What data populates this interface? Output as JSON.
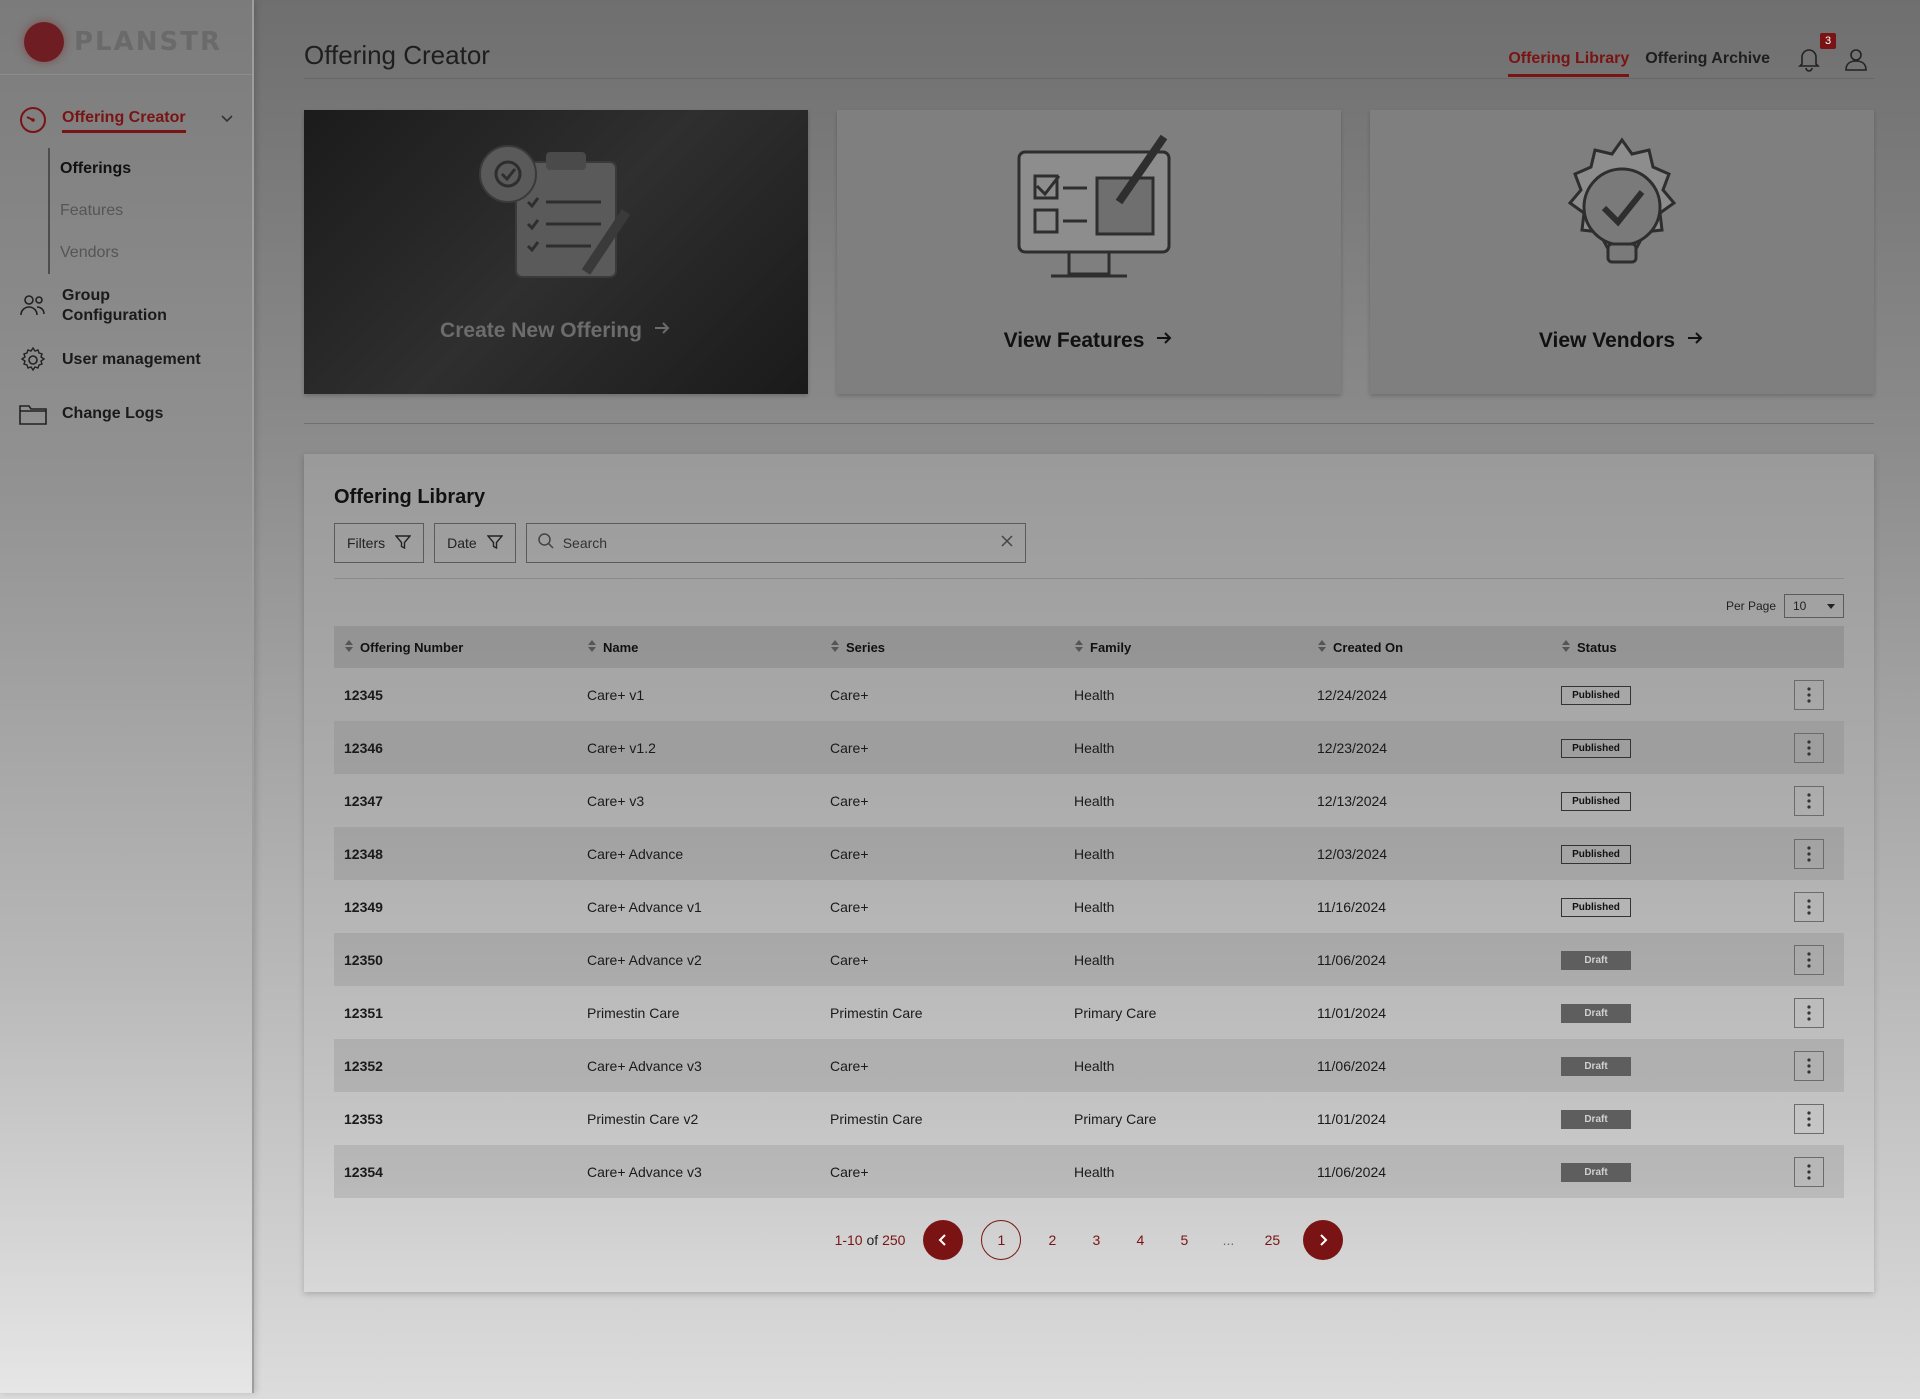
{
  "brand": {
    "logo_text": "PLANSTR"
  },
  "header": {
    "title": "Offering Creator",
    "tabs": [
      {
        "label": "Offering Library"
      },
      {
        "label": "Offering Archive"
      }
    ],
    "notification_count": "3"
  },
  "sidebar": {
    "group": {
      "label": "Offering Creator"
    },
    "sub_items": [
      {
        "label": "Offerings"
      },
      {
        "label": "Features"
      },
      {
        "label": "Vendors"
      }
    ],
    "items": [
      {
        "label": "Group Configuration"
      },
      {
        "label": "User management"
      },
      {
        "label": "Change Logs"
      }
    ]
  },
  "cards": [
    {
      "label": "Create New Offering"
    },
    {
      "label": "View Features"
    },
    {
      "label": "View Vendors"
    }
  ],
  "library": {
    "title": "Offering Library",
    "filters_label": "Filters",
    "date_label": "Date",
    "search_placeholder": "Search",
    "per_page_label": "Per Page",
    "per_page_value": "10",
    "columns": [
      "Offering Number",
      "Name",
      "Series",
      "Family",
      "Created On",
      "Status"
    ],
    "rows": [
      {
        "number": "12345",
        "name": "Care+ v1",
        "series": "Care+",
        "family": "Health",
        "created": "12/24/2024",
        "status": "Published"
      },
      {
        "number": "12346",
        "name": "Care+ v1.2",
        "series": "Care+",
        "family": "Health",
        "created": "12/23/2024",
        "status": "Published"
      },
      {
        "number": "12347",
        "name": "Care+ v3",
        "series": "Care+",
        "family": "Health",
        "created": "12/13/2024",
        "status": "Published"
      },
      {
        "number": "12348",
        "name": "Care+ Advance",
        "series": "Care+",
        "family": "Health",
        "created": "12/03/2024",
        "status": "Published"
      },
      {
        "number": "12349",
        "name": "Care+ Advance v1",
        "series": "Care+",
        "family": "Health",
        "created": "11/16/2024",
        "status": "Published"
      },
      {
        "number": "12350",
        "name": "Care+ Advance v2",
        "series": "Care+",
        "family": "Health",
        "created": "11/06/2024",
        "status": "Draft"
      },
      {
        "number": "12351",
        "name": "Primestin Care",
        "series": "Primestin Care",
        "family": "Primary Care",
        "created": "11/01/2024",
        "status": "Draft"
      },
      {
        "number": "12352",
        "name": "Care+ Advance v3",
        "series": "Care+",
        "family": "Health",
        "created": "11/06/2024",
        "status": "Draft"
      },
      {
        "number": "12353",
        "name": "Primestin Care v2",
        "series": "Primestin Care",
        "family": "Primary Care",
        "created": "11/01/2024",
        "status": "Draft"
      },
      {
        "number": "12354",
        "name": "Care+ Advance v3",
        "series": "Care+",
        "family": "Health",
        "created": "11/06/2024",
        "status": "Draft"
      }
    ],
    "pagination": {
      "range": "1-10",
      "of": "of",
      "total": "250",
      "pages": [
        "1",
        "2",
        "3",
        "4",
        "5",
        "...",
        "25"
      ],
      "current": "1"
    }
  },
  "colors": {
    "accent": "#7a1414",
    "draft_badge": "#5e5e5e"
  }
}
